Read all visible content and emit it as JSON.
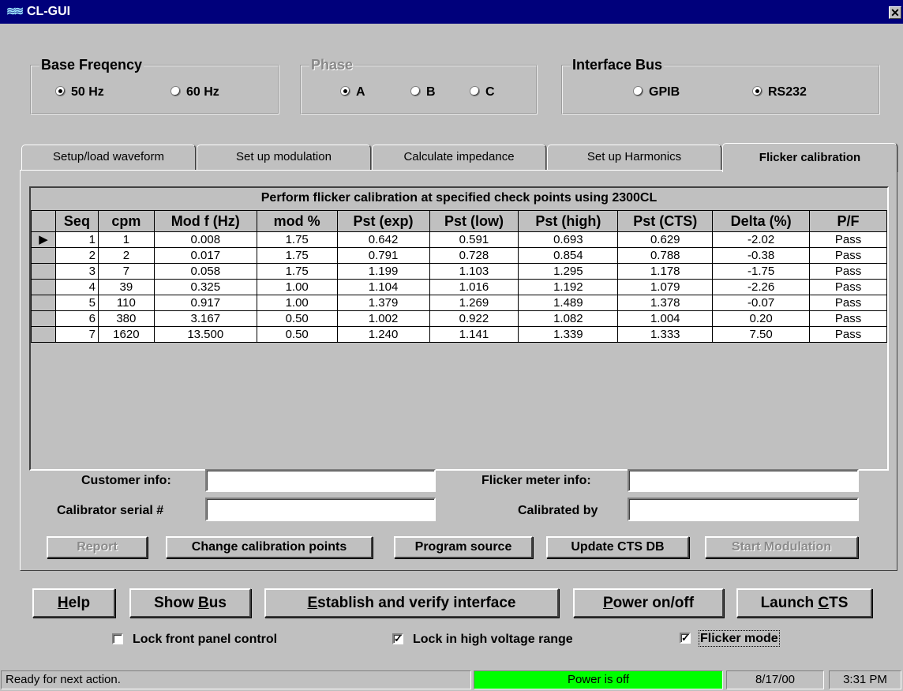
{
  "window": {
    "title": "CL-GUI",
    "icon": "app-logo-icon",
    "close_label": "✕"
  },
  "base_frequency": {
    "label": "Base Freqency",
    "options": [
      "50 Hz",
      "60 Hz"
    ],
    "selected": "50 Hz"
  },
  "phase": {
    "label": "Phase",
    "options": [
      "A",
      "B",
      "C"
    ],
    "selected": "A",
    "disabled": true
  },
  "interface_bus": {
    "label": "Interface Bus",
    "options": [
      "GPIB",
      "RS232"
    ],
    "selected": "RS232"
  },
  "tabs": [
    {
      "label": "Setup/load waveform"
    },
    {
      "label": "Set up modulation"
    },
    {
      "label": "Calculate impedance"
    },
    {
      "label": "Set up Harmonics"
    },
    {
      "label": "Flicker calibration",
      "active": true
    }
  ],
  "grid": {
    "caption": "Perform flicker calibration at specified check points using 2300CL",
    "columns": [
      "Seq",
      "cpm",
      "Mod f (Hz)",
      "mod %",
      "Pst (exp)",
      "Pst (low)",
      "Pst (high)",
      "Pst (CTS)",
      "Delta (%)",
      "P/F"
    ],
    "rows": [
      [
        "1",
        "1",
        "0.008",
        "1.75",
        "0.642",
        "0.591",
        "0.693",
        "0.629",
        "-2.02",
        "Pass"
      ],
      [
        "2",
        "2",
        "0.017",
        "1.75",
        "0.791",
        "0.728",
        "0.854",
        "0.788",
        "-0.38",
        "Pass"
      ],
      [
        "3",
        "7",
        "0.058",
        "1.75",
        "1.199",
        "1.103",
        "1.295",
        "1.178",
        "-1.75",
        "Pass"
      ],
      [
        "4",
        "39",
        "0.325",
        "1.00",
        "1.104",
        "1.016",
        "1.192",
        "1.079",
        "-2.26",
        "Pass"
      ],
      [
        "5",
        "110",
        "0.917",
        "1.00",
        "1.379",
        "1.269",
        "1.489",
        "1.378",
        "-0.07",
        "Pass"
      ],
      [
        "6",
        "380",
        "3.167",
        "0.50",
        "1.002",
        "0.922",
        "1.082",
        "1.004",
        "0.20",
        "Pass"
      ],
      [
        "7",
        "1620",
        "13.500",
        "0.50",
        "1.240",
        "1.141",
        "1.339",
        "1.333",
        "7.50",
        "Pass"
      ]
    ],
    "current_row_marker": "▶"
  },
  "fields": {
    "customer_info": {
      "label": "Customer info:",
      "value": ""
    },
    "flicker_meter_info": {
      "label": "Flicker meter info:",
      "value": ""
    },
    "calibrator_serial": {
      "label": "Calibrator serial #",
      "value": ""
    },
    "calibrated_by": {
      "label": "Calibrated by",
      "value": ""
    }
  },
  "panel_buttons": {
    "report": "Report",
    "change_points": "Change calibration points",
    "program_source": "Program source",
    "update_cts_db": "Update CTS DB",
    "start_modulation": "Start Modulation"
  },
  "main_buttons": {
    "help": {
      "hot": "H",
      "rest": "elp"
    },
    "show_bus": {
      "pre": "Show ",
      "hot": "B",
      "rest": "us"
    },
    "establish": {
      "hot": "E",
      "rest": "stablish and verify interface"
    },
    "power": {
      "hot": "P",
      "rest": "ower on/off"
    },
    "launch_cts": {
      "pre": "Launch ",
      "hot": "C",
      "rest": "TS"
    }
  },
  "checkboxes": {
    "lock_front_panel": {
      "label": "Lock front panel control",
      "checked": false
    },
    "lock_high_voltage": {
      "label": "Lock in high voltage range",
      "checked": true
    },
    "flicker_mode": {
      "label": "Flicker mode",
      "checked": true
    }
  },
  "status": {
    "message": "Ready for next action.",
    "power": "Power is off",
    "power_color": "#00ff00",
    "date": "8/17/00",
    "time": "3:31 PM"
  }
}
